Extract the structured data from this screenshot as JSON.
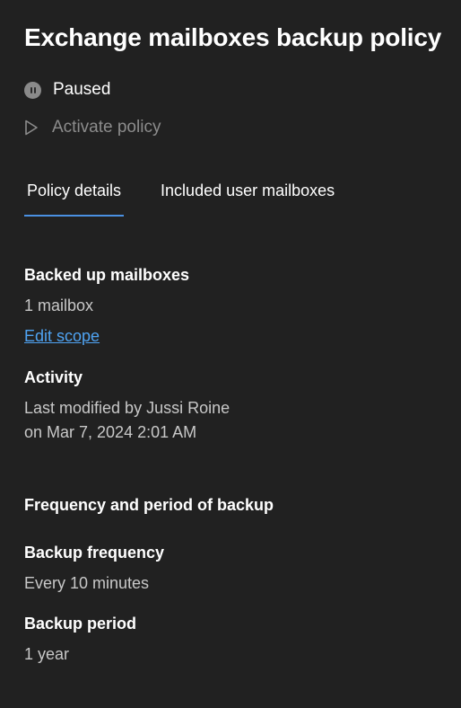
{
  "header": {
    "title": "Exchange mailboxes backup policy"
  },
  "status": {
    "icon": "pause-circle-icon",
    "label": "Paused"
  },
  "actions": {
    "activate_icon": "play-icon",
    "activate_label": "Activate policy"
  },
  "tabs": [
    {
      "label": "Policy details",
      "active": true
    },
    {
      "label": "Included user mailboxes",
      "active": false
    }
  ],
  "details": {
    "backed_up": {
      "heading": "Backed up mailboxes",
      "value": "1 mailbox",
      "link": "Edit scope"
    },
    "activity": {
      "heading": "Activity",
      "line1": "Last modified by Jussi Roine",
      "line2": "on Mar 7, 2024 2:01 AM"
    },
    "frequency_section": {
      "heading": "Frequency and period of backup",
      "frequency_label": "Backup frequency",
      "frequency_value": "Every 10 minutes",
      "period_label": "Backup period",
      "period_value": "1 year"
    }
  },
  "colors": {
    "background": "#212121",
    "accent": "#4a90e2",
    "link": "#4fa3f2"
  }
}
